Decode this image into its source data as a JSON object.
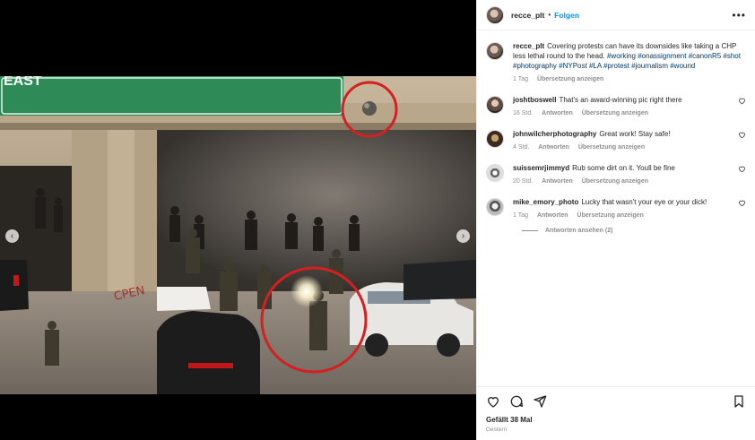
{
  "post": {
    "username": "recce_plt",
    "follow_label": "Folgen",
    "separator": "•",
    "caption_user": "recce_plt",
    "caption_text": "Covering protests can have its downsides like taking a CHP less lethal round to the head.",
    "caption_tags": "#working #onassignment #canonR5 #shot #photography #NYPost #LA #protest #journalism #wound",
    "caption_time": "1 Tag",
    "caption_translate": "Übersetzung anzeigen"
  },
  "comments": [
    {
      "user": "joshtboswell",
      "text": "That's an award-winning pic right there",
      "time": "16 Std.",
      "reply": "Antworten",
      "translate": "Übersetzung anzeigen"
    },
    {
      "user": "johnwilcherphotography",
      "text": "Great work! Stay safe!",
      "time": "4 Std.",
      "reply": "Antworten",
      "translate": "Übersetzung anzeigen"
    },
    {
      "user": "suissemrjimmyd",
      "text": "Rub some dirt on it. Youll be fine",
      "time": "20 Std.",
      "reply": "Antworten",
      "translate": "Übersetzung anzeigen"
    },
    {
      "user": "mike_emory_photo",
      "text": "Lucky that wasn't your eye or your dick!",
      "time": "1 Tag",
      "reply": "Antworten",
      "translate": "Übersetzung anzeigen"
    }
  ],
  "view_replies": "Antworten ansehen (2)",
  "likes": "Gefällt 38 Mal",
  "posted_when": "Gestern",
  "sign_text": "EAST",
  "graffiti_text": "CPEN",
  "nav": {
    "prev": "‹",
    "next": "›"
  },
  "colors": {
    "link": "#0095f6",
    "hashtag": "#00376b",
    "meta": "#8e8e8e",
    "sign_green": "#2e8b57",
    "circle_red": "#d32020"
  }
}
